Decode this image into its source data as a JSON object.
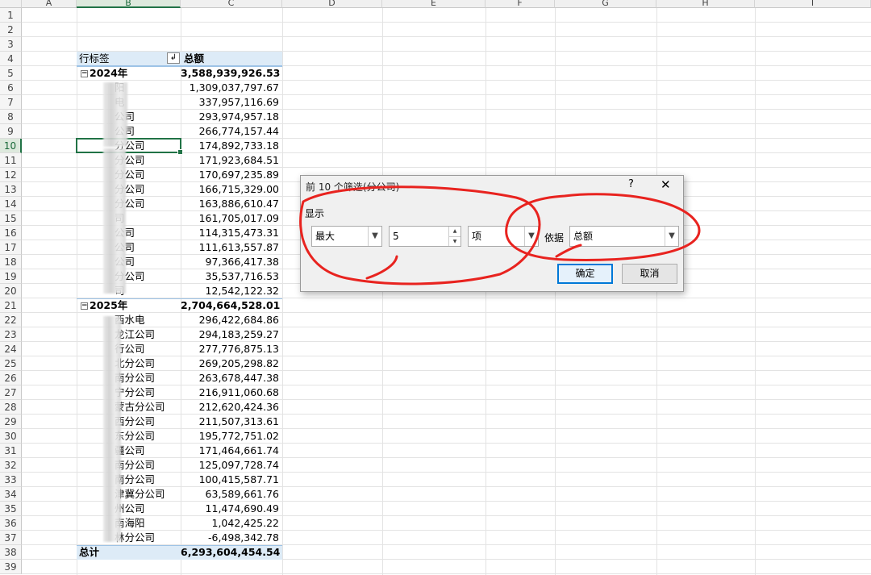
{
  "columns": [
    "A",
    "B",
    "C",
    "D",
    "E",
    "F",
    "G",
    "H",
    "I"
  ],
  "rows": [
    "1",
    "2",
    "3",
    "4",
    "5",
    "6",
    "7",
    "8",
    "9",
    "10",
    "11",
    "12",
    "13",
    "14",
    "15",
    "16",
    "17",
    "18",
    "19",
    "20",
    "21",
    "22",
    "23",
    "24",
    "25",
    "26",
    "27",
    "28",
    "29",
    "30",
    "31",
    "32",
    "33",
    "34",
    "35",
    "36",
    "37",
    "38",
    "39"
  ],
  "pivot": {
    "header_label": "行标签",
    "header_value": "总额",
    "collapse_symbol": "⊟",
    "groups": [
      {
        "label": "2024年",
        "total": "3,588,939,926.53",
        "items": [
          {
            "label": "阳",
            "value": "1,309,037,797.67"
          },
          {
            "label": "电",
            "value": "337,957,116.69"
          },
          {
            "label": "公司",
            "value": "293,974,957.18"
          },
          {
            "label": "公司",
            "value": "266,774,157.44"
          },
          {
            "label": "分公司",
            "value": "174,892,733.18"
          },
          {
            "label": "分公司",
            "value": "171,923,684.51"
          },
          {
            "label": "分公司",
            "value": "170,697,235.89"
          },
          {
            "label": "分公司",
            "value": "166,715,329.00"
          },
          {
            "label": "分公司",
            "value": "163,886,610.47"
          },
          {
            "label": "司",
            "value": "161,705,017.09"
          },
          {
            "label": "公司",
            "value": "114,315,473.31"
          },
          {
            "label": "公司",
            "value": "111,613,557.87"
          },
          {
            "label": "公司",
            "value": "97,366,417.38"
          },
          {
            "label": "分公司",
            "value": "35,537,716.53"
          },
          {
            "label": "司",
            "value": "12,542,122.32"
          }
        ]
      },
      {
        "label": "2025年",
        "total": "2,704,664,528.01",
        "items": [
          {
            "label": "西水电",
            "value": "296,422,684.86"
          },
          {
            "label": "龙江公司",
            "value": "294,183,259.27"
          },
          {
            "label": "行公司",
            "value": "277,776,875.13"
          },
          {
            "label": "北分公司",
            "value": "269,205,298.82"
          },
          {
            "label": "南分公司",
            "value": "263,678,447.38"
          },
          {
            "label": "宁分公司",
            "value": "216,911,060.68"
          },
          {
            "label": "蒙古分公司",
            "value": "212,620,424.36"
          },
          {
            "label": "西分公司",
            "value": "211,507,313.61"
          },
          {
            "label": "东分公司",
            "value": "195,772,751.02"
          },
          {
            "label": "疆公司",
            "value": "171,464,661.74"
          },
          {
            "label": "南分公司",
            "value": "125,097,728.74"
          },
          {
            "label": "南分公司",
            "value": "100,415,587.71"
          },
          {
            "label": "津冀分公司",
            "value": "63,589,661.76"
          },
          {
            "label": "州公司",
            "value": "11,474,690.49"
          },
          {
            "label": "南海阳",
            "value": "1,042,425.22"
          },
          {
            "label": "林分公司",
            "value": "-6,498,342.78"
          }
        ]
      }
    ],
    "grand_total_label": "总计",
    "grand_total_value": "6,293,604,454.54"
  },
  "dialog": {
    "title": "前 10 个筛选(分公司)",
    "help": "?",
    "close": "✕",
    "section_label": "显示",
    "show_type": "最大",
    "count": "5",
    "unit": "项",
    "basis_label": "依据",
    "basis_field": "总额",
    "ok_label": "确定",
    "cancel_label": "取消"
  },
  "colors": {
    "accent_green": "#217346",
    "pivot_band": "#ddebf7",
    "annotation_red": "#e8231f"
  }
}
